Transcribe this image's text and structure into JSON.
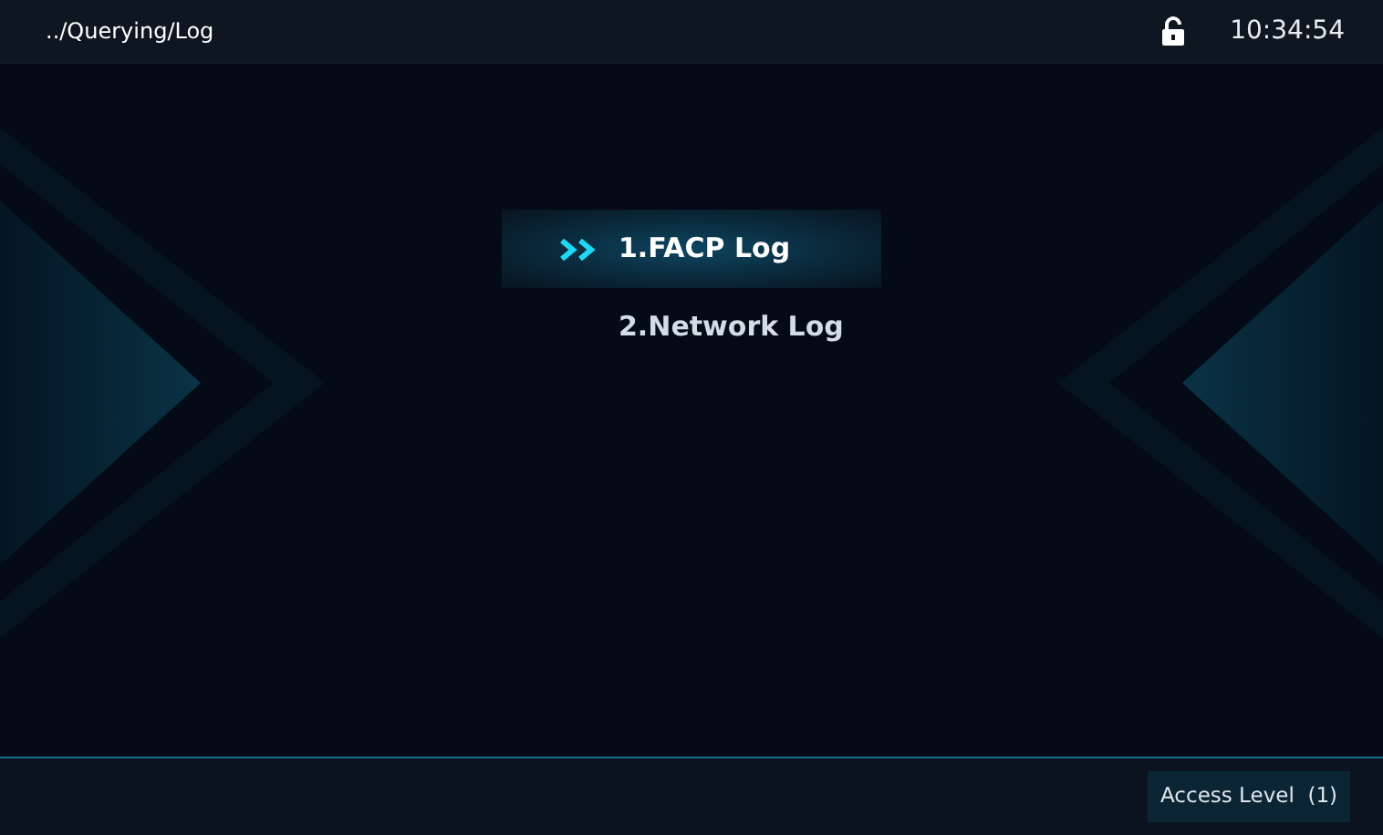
{
  "header": {
    "path": "../Querying/Log",
    "locked": false,
    "time": "10:34:54"
  },
  "menu": [
    {
      "label": "1.FACP Log",
      "selected": true
    },
    {
      "label": "2.Network Log",
      "selected": false
    }
  ],
  "footer": {
    "access_level": "Access Level  (1)"
  }
}
